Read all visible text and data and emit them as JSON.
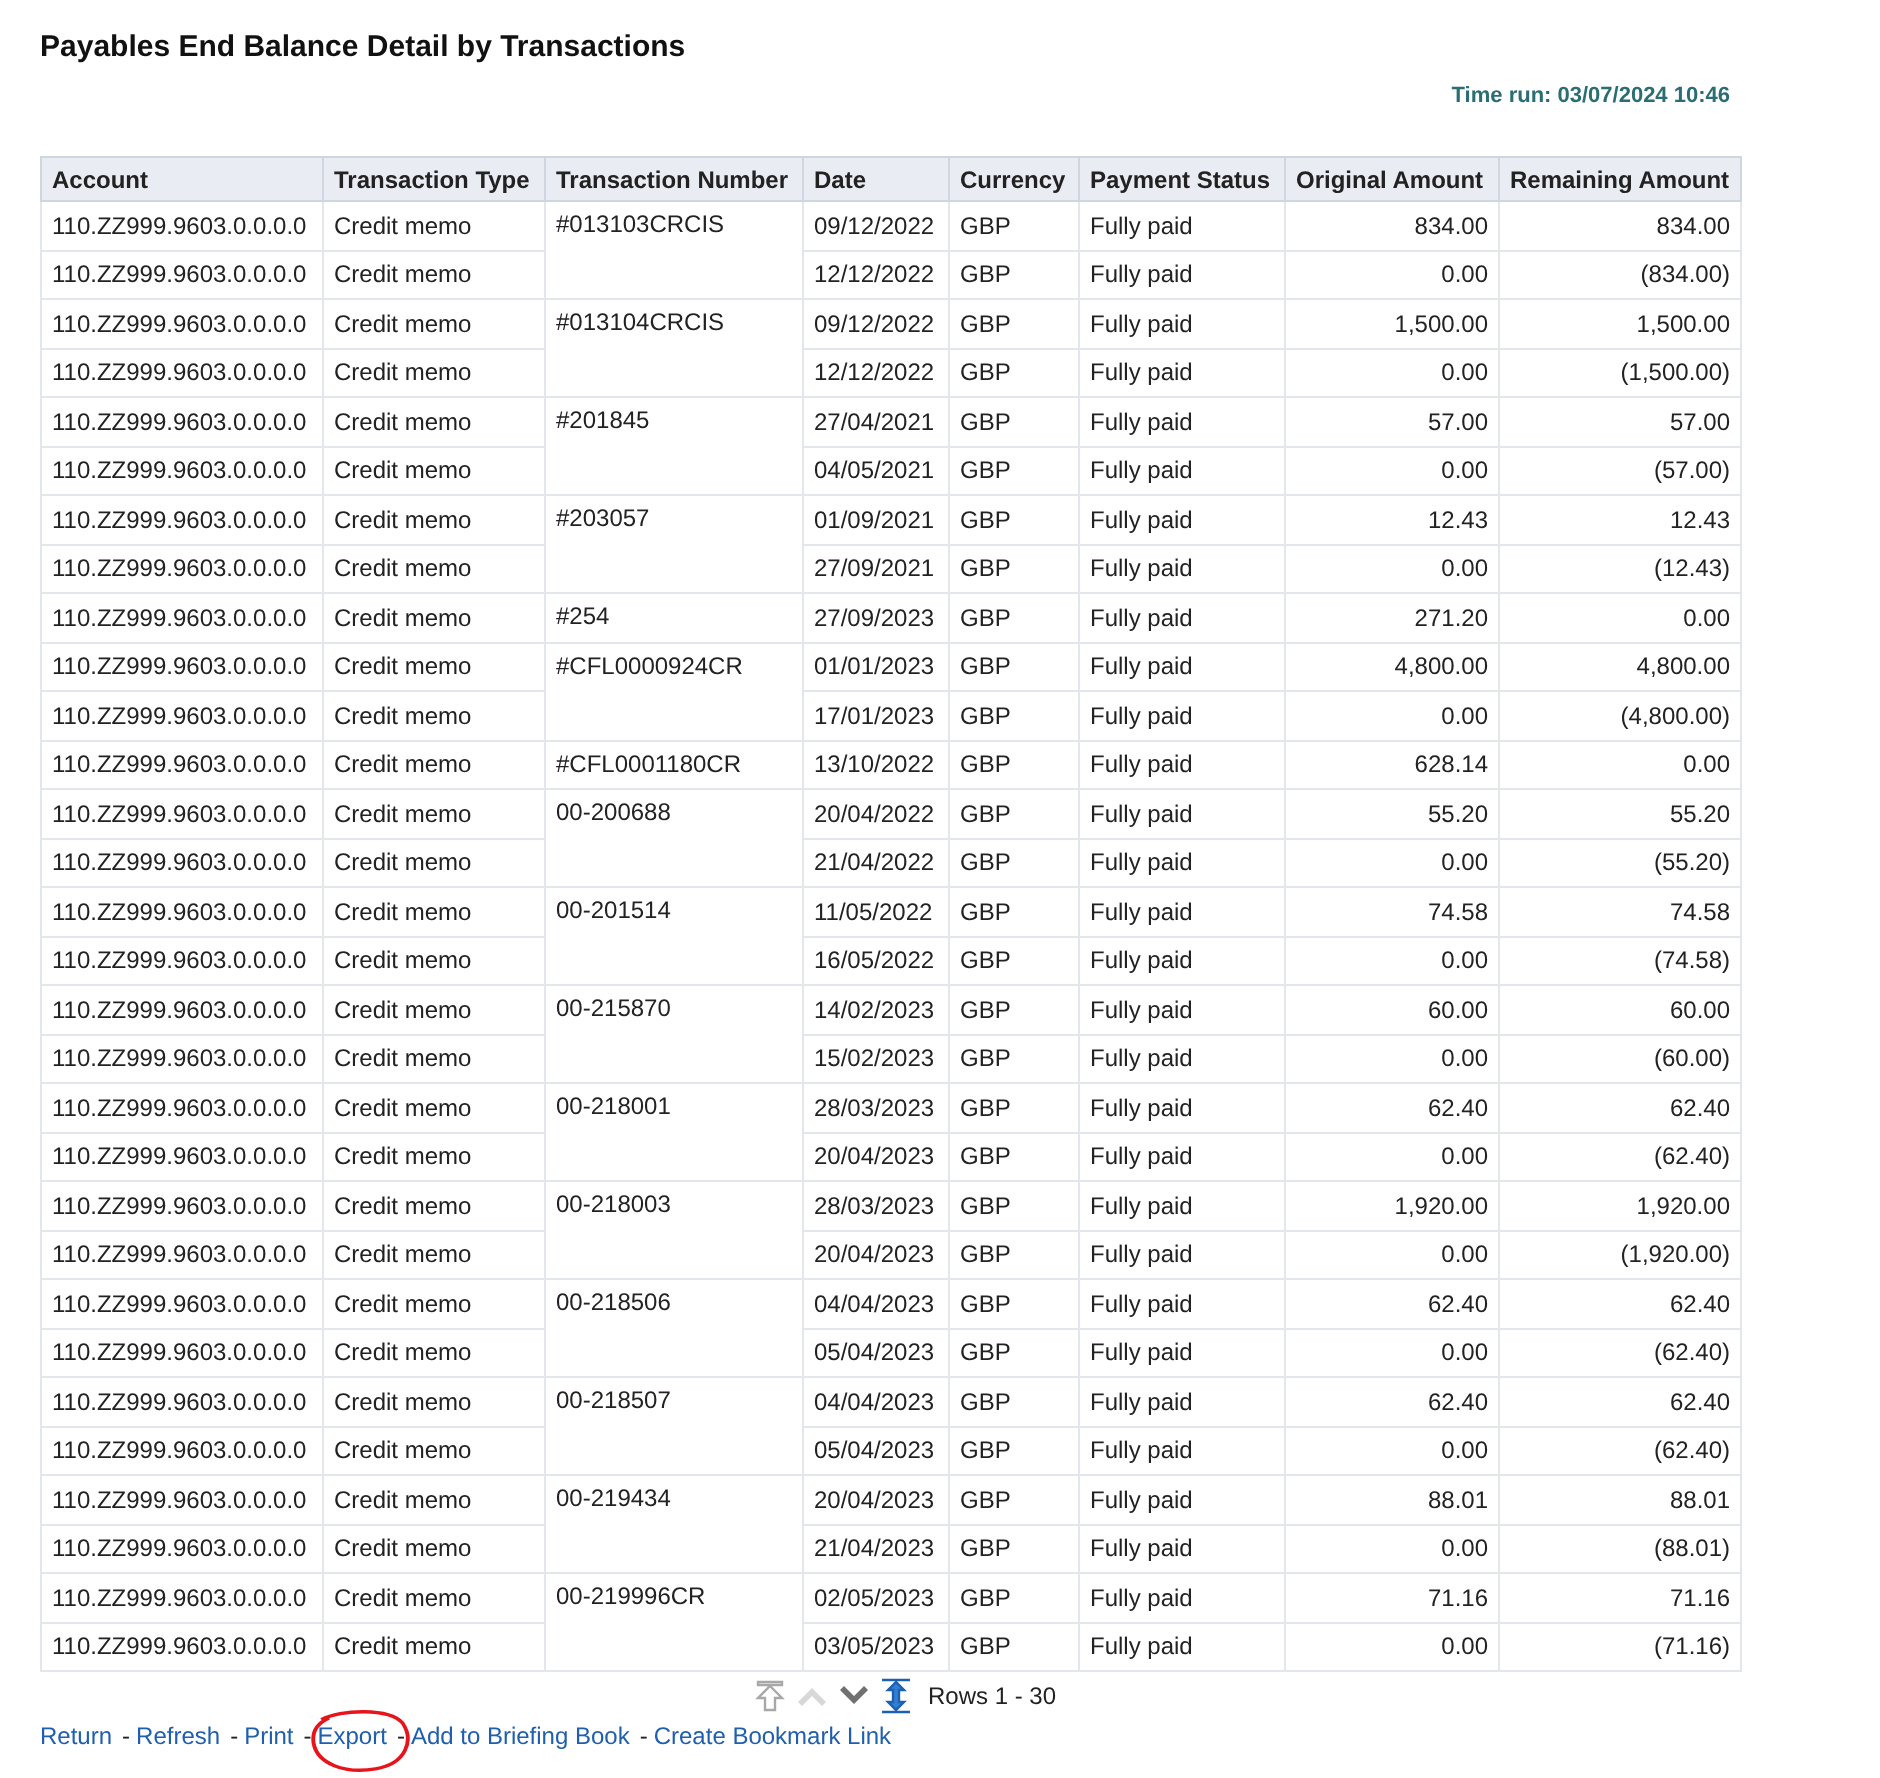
{
  "title": "Payables End Balance Detail by Transactions",
  "time_run": "Time run: 03/07/2024 10:46",
  "table": {
    "columns": [
      "Account",
      "Transaction Type",
      "Transaction Number",
      "Date",
      "Currency",
      "Payment Status",
      "Original Amount",
      "Remaining Amount"
    ],
    "groups": [
      {
        "number": "#013103CRCIS",
        "rows": [
          [
            "110.ZZ999.9603.0.0.0.0",
            "Credit memo",
            "09/12/2022",
            "GBP",
            "Fully paid",
            "834.00",
            "834.00"
          ],
          [
            "110.ZZ999.9603.0.0.0.0",
            "Credit memo",
            "12/12/2022",
            "GBP",
            "Fully paid",
            "0.00",
            "(834.00)"
          ]
        ]
      },
      {
        "number": "#013104CRCIS",
        "rows": [
          [
            "110.ZZ999.9603.0.0.0.0",
            "Credit memo",
            "09/12/2022",
            "GBP",
            "Fully paid",
            "1,500.00",
            "1,500.00"
          ],
          [
            "110.ZZ999.9603.0.0.0.0",
            "Credit memo",
            "12/12/2022",
            "GBP",
            "Fully paid",
            "0.00",
            "(1,500.00)"
          ]
        ]
      },
      {
        "number": "#201845",
        "rows": [
          [
            "110.ZZ999.9603.0.0.0.0",
            "Credit memo",
            "27/04/2021",
            "GBP",
            "Fully paid",
            "57.00",
            "57.00"
          ],
          [
            "110.ZZ999.9603.0.0.0.0",
            "Credit memo",
            "04/05/2021",
            "GBP",
            "Fully paid",
            "0.00",
            "(57.00)"
          ]
        ]
      },
      {
        "number": "#203057",
        "rows": [
          [
            "110.ZZ999.9603.0.0.0.0",
            "Credit memo",
            "01/09/2021",
            "GBP",
            "Fully paid",
            "12.43",
            "12.43"
          ],
          [
            "110.ZZ999.9603.0.0.0.0",
            "Credit memo",
            "27/09/2021",
            "GBP",
            "Fully paid",
            "0.00",
            "(12.43)"
          ]
        ]
      },
      {
        "number": "#254",
        "rows": [
          [
            "110.ZZ999.9603.0.0.0.0",
            "Credit memo",
            "27/09/2023",
            "GBP",
            "Fully paid",
            "271.20",
            "0.00"
          ]
        ]
      },
      {
        "number": "#CFL0000924CR",
        "rows": [
          [
            "110.ZZ999.9603.0.0.0.0",
            "Credit memo",
            "01/01/2023",
            "GBP",
            "Fully paid",
            "4,800.00",
            "4,800.00"
          ],
          [
            "110.ZZ999.9603.0.0.0.0",
            "Credit memo",
            "17/01/2023",
            "GBP",
            "Fully paid",
            "0.00",
            "(4,800.00)"
          ]
        ]
      },
      {
        "number": "#CFL0001180CR",
        "rows": [
          [
            "110.ZZ999.9603.0.0.0.0",
            "Credit memo",
            "13/10/2022",
            "GBP",
            "Fully paid",
            "628.14",
            "0.00"
          ]
        ]
      },
      {
        "number": "00-200688",
        "rows": [
          [
            "110.ZZ999.9603.0.0.0.0",
            "Credit memo",
            "20/04/2022",
            "GBP",
            "Fully paid",
            "55.20",
            "55.20"
          ],
          [
            "110.ZZ999.9603.0.0.0.0",
            "Credit memo",
            "21/04/2022",
            "GBP",
            "Fully paid",
            "0.00",
            "(55.20)"
          ]
        ]
      },
      {
        "number": "00-201514",
        "rows": [
          [
            "110.ZZ999.9603.0.0.0.0",
            "Credit memo",
            "11/05/2022",
            "GBP",
            "Fully paid",
            "74.58",
            "74.58"
          ],
          [
            "110.ZZ999.9603.0.0.0.0",
            "Credit memo",
            "16/05/2022",
            "GBP",
            "Fully paid",
            "0.00",
            "(74.58)"
          ]
        ]
      },
      {
        "number": "00-215870",
        "rows": [
          [
            "110.ZZ999.9603.0.0.0.0",
            "Credit memo",
            "14/02/2023",
            "GBP",
            "Fully paid",
            "60.00",
            "60.00"
          ],
          [
            "110.ZZ999.9603.0.0.0.0",
            "Credit memo",
            "15/02/2023",
            "GBP",
            "Fully paid",
            "0.00",
            "(60.00)"
          ]
        ]
      },
      {
        "number": "00-218001",
        "rows": [
          [
            "110.ZZ999.9603.0.0.0.0",
            "Credit memo",
            "28/03/2023",
            "GBP",
            "Fully paid",
            "62.40",
            "62.40"
          ],
          [
            "110.ZZ999.9603.0.0.0.0",
            "Credit memo",
            "20/04/2023",
            "GBP",
            "Fully paid",
            "0.00",
            "(62.40)"
          ]
        ]
      },
      {
        "number": "00-218003",
        "rows": [
          [
            "110.ZZ999.9603.0.0.0.0",
            "Credit memo",
            "28/03/2023",
            "GBP",
            "Fully paid",
            "1,920.00",
            "1,920.00"
          ],
          [
            "110.ZZ999.9603.0.0.0.0",
            "Credit memo",
            "20/04/2023",
            "GBP",
            "Fully paid",
            "0.00",
            "(1,920.00)"
          ]
        ]
      },
      {
        "number": "00-218506",
        "rows": [
          [
            "110.ZZ999.9603.0.0.0.0",
            "Credit memo",
            "04/04/2023",
            "GBP",
            "Fully paid",
            "62.40",
            "62.40"
          ],
          [
            "110.ZZ999.9603.0.0.0.0",
            "Credit memo",
            "05/04/2023",
            "GBP",
            "Fully paid",
            "0.00",
            "(62.40)"
          ]
        ]
      },
      {
        "number": "00-218507",
        "rows": [
          [
            "110.ZZ999.9603.0.0.0.0",
            "Credit memo",
            "04/04/2023",
            "GBP",
            "Fully paid",
            "62.40",
            "62.40"
          ],
          [
            "110.ZZ999.9603.0.0.0.0",
            "Credit memo",
            "05/04/2023",
            "GBP",
            "Fully paid",
            "0.00",
            "(62.40)"
          ]
        ]
      },
      {
        "number": "00-219434",
        "rows": [
          [
            "110.ZZ999.9603.0.0.0.0",
            "Credit memo",
            "20/04/2023",
            "GBP",
            "Fully paid",
            "88.01",
            "88.01"
          ],
          [
            "110.ZZ999.9603.0.0.0.0",
            "Credit memo",
            "21/04/2023",
            "GBP",
            "Fully paid",
            "0.00",
            "(88.01)"
          ]
        ]
      },
      {
        "number": "00-219996CR",
        "rows": [
          [
            "110.ZZ999.9603.0.0.0.0",
            "Credit memo",
            "02/05/2023",
            "GBP",
            "Fully paid",
            "71.16",
            "71.16"
          ],
          [
            "110.ZZ999.9603.0.0.0.0",
            "Credit memo",
            "03/05/2023",
            "GBP",
            "Fully paid",
            "0.00",
            "(71.16)"
          ]
        ]
      }
    ]
  },
  "pagination": {
    "label": "Rows 1 - 30"
  },
  "links": [
    {
      "label": "Return",
      "circled": false
    },
    {
      "label": "Refresh",
      "circled": false
    },
    {
      "label": "Print",
      "circled": false
    },
    {
      "label": "Export",
      "circled": true
    },
    {
      "label": "Add to Briefing Book",
      "circled": false
    },
    {
      "label": "Create Bookmark Link",
      "circled": false
    }
  ],
  "link_separator": "-"
}
